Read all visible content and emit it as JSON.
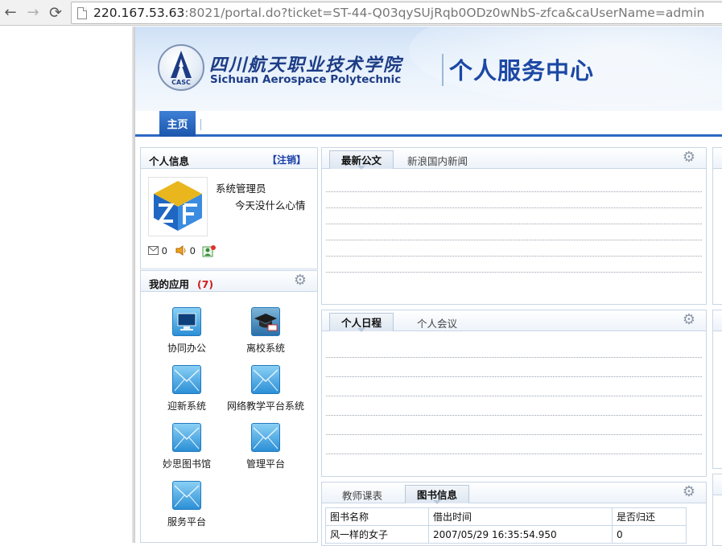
{
  "browser": {
    "url_host": "220.167.53.63",
    "url_rest": ":8021/portal.do?ticket=ST-44-Q03qySUjRqb0ODz0wNbS-zfca&caUserName=admin",
    "back_icon": "back-arrow-icon",
    "forward_icon": "forward-arrow-icon",
    "reload_icon": "reload-icon"
  },
  "header": {
    "logo_text": "CASC",
    "school_name_cn": "四川航天职业技术学院",
    "school_name_en": "Sichuan Aerospace Polytechnic",
    "portal_title": "个人服务中心"
  },
  "nav": {
    "home": "主页"
  },
  "profile": {
    "title": "个人信息",
    "logout": "【注销】",
    "name": "系统管理员",
    "mood": "今天没什么心情",
    "mail_count": "0",
    "notice_count": "0"
  },
  "apps": {
    "title": "我的应用",
    "count": "(7)",
    "items": [
      {
        "label": "协同办公",
        "icon": "monitor-icon"
      },
      {
        "label": "离校系统",
        "icon": "graduation-cap-icon"
      },
      {
        "label": "迎新系统",
        "icon": "envelope-icon"
      },
      {
        "label": "网络教学平台系统",
        "icon": "envelope-icon"
      },
      {
        "label": "妙思图书馆",
        "icon": "envelope-icon"
      },
      {
        "label": "管理平台",
        "icon": "envelope-icon"
      },
      {
        "label": "服务平台",
        "icon": "envelope-icon"
      }
    ]
  },
  "news": {
    "tab_active": "最新公文",
    "tab_other": "新浪国内新闻"
  },
  "schedule": {
    "tab_active": "个人日程",
    "tab_other": "个人会议"
  },
  "library": {
    "tab_other": "教师课表",
    "tab_active": "图书信息",
    "columns": [
      "图书名称",
      "借出时间",
      "是否归还"
    ],
    "rows": [
      [
        "风一样的女子",
        "2007/05/29 16:35:54.950",
        "0"
      ]
    ]
  },
  "colors": {
    "accent": "#2b68c4",
    "title_blue": "#1c48a5",
    "count_red": "#d31b1b"
  }
}
